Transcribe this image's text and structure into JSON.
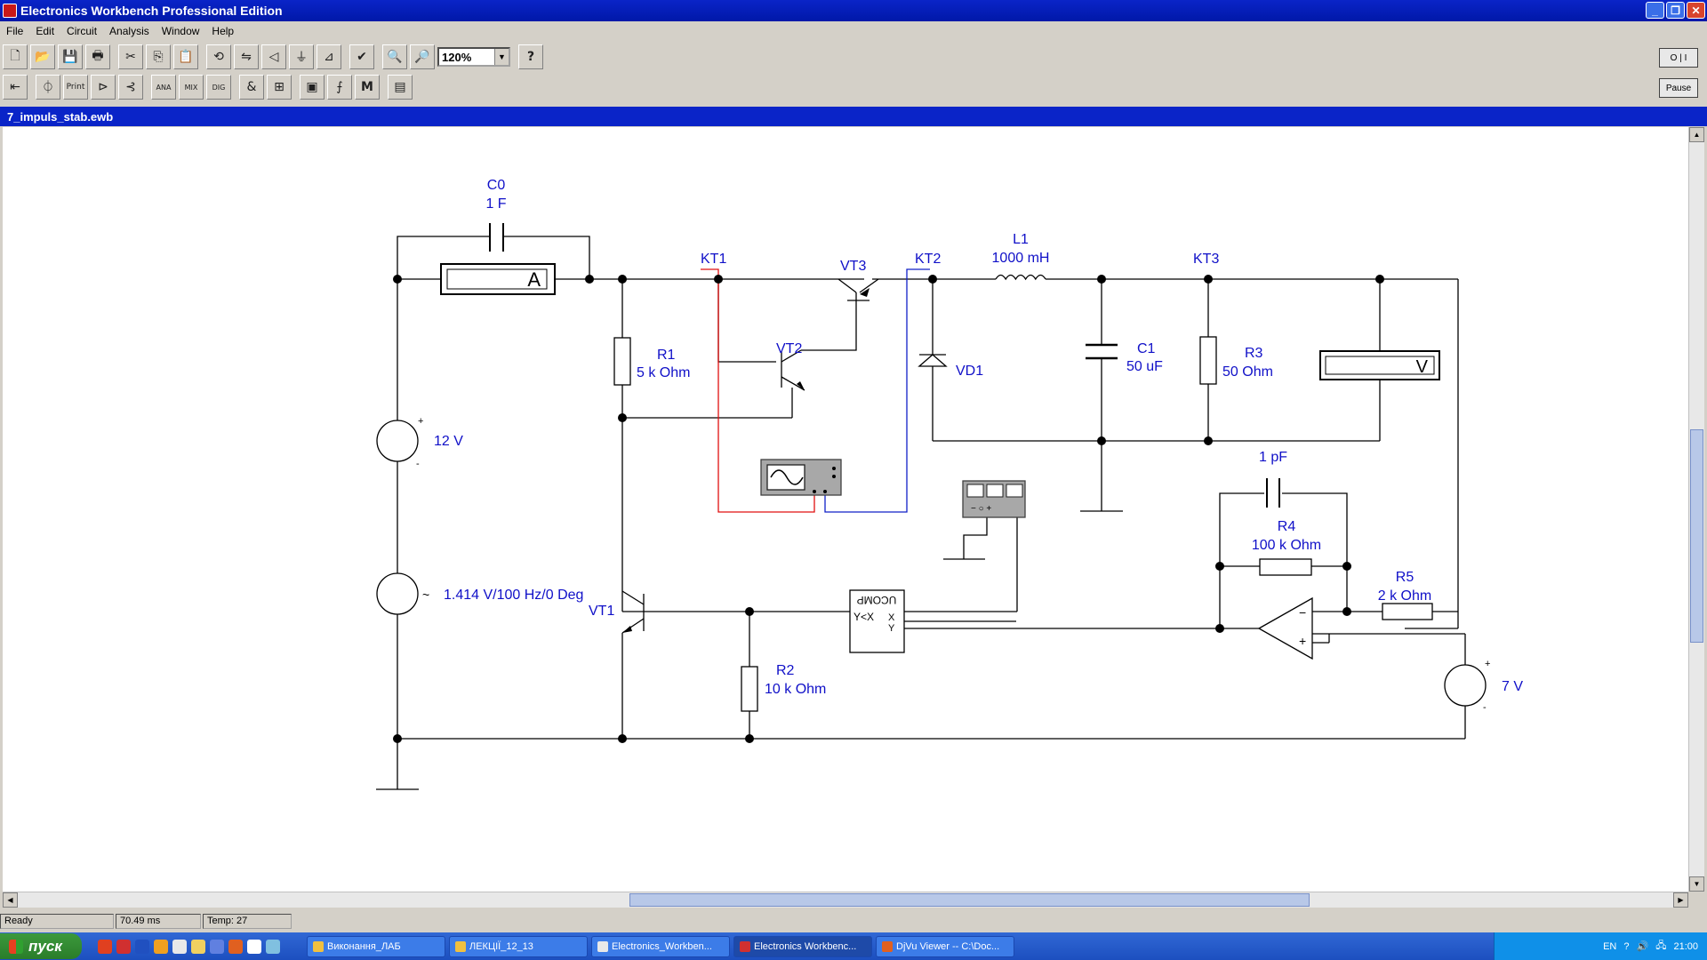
{
  "window": {
    "title": "Electronics Workbench Professional Edition"
  },
  "menu": [
    "File",
    "Edit",
    "Circuit",
    "Analysis",
    "Window",
    "Help"
  ],
  "toolbar": {
    "zoom": "120%",
    "help": "?",
    "print_label": "Print",
    "pause_label": "Pause"
  },
  "document": {
    "title": "7_impuls_stab.ewb"
  },
  "circuit": {
    "C0": {
      "name": "C0",
      "value": "1 F"
    },
    "ammeter": "A",
    "voltmeter": "V",
    "L1": {
      "name": "L1",
      "value": "1000 mH"
    },
    "KT1": "KT1",
    "KT2": "KT2",
    "KT3": "KT3",
    "VT1": "VT1",
    "VT2": "VT2",
    "VT3": "VT3",
    "R1": {
      "name": "R1",
      "value": "5 k Ohm"
    },
    "VD1": "VD1",
    "C1": {
      "name": "C1",
      "value": "50 uF"
    },
    "R3": {
      "name": "R3",
      "value": "50  Ohm"
    },
    "V12": "12 V",
    "Vac": "1.414 V/100 Hz/0 Deg",
    "Cf": "1 pF",
    "R4": {
      "name": "R4",
      "value": "100 k Ohm"
    },
    "R5": {
      "name": "R5",
      "value": "2 k Ohm"
    },
    "R2": {
      "name": "R2",
      "value": "10 k Ohm"
    },
    "V7": "7 V",
    "comparator": {
      "name": "UCOMP",
      "cond": "Y<X",
      "x": "X",
      "y": "Y"
    },
    "plus": "+",
    "minus": "-"
  },
  "status": {
    "state": "Ready",
    "time": "70.49 ms",
    "temp": "Temp:  27"
  },
  "taskbar": {
    "start": "пуск",
    "tasks": [
      "Виконання_ЛАБ",
      "ЛЕКЦІЇ_12_13",
      "Electronics_Workben...",
      "Electronics Workbenc...",
      "DjVu Viewer -- C:\\Doc..."
    ],
    "lang": "EN",
    "clock": "21:00"
  }
}
